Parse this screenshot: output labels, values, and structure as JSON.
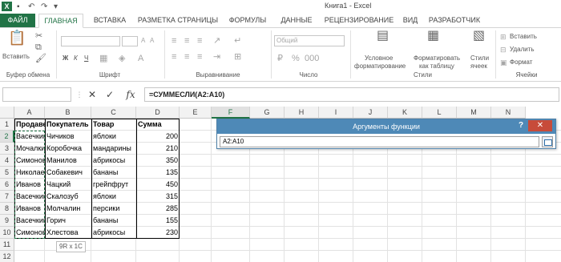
{
  "window": {
    "title": "Книга1 - Excel",
    "logo": "X"
  },
  "qat": {
    "save": "▪",
    "undo": "↶",
    "redo": "↷",
    "customize": "▾"
  },
  "tabs": {
    "file": "ФАЙЛ",
    "items": [
      "ГЛАВНАЯ",
      "ВСТАВКА",
      "РАЗМЕТКА СТРАНИЦЫ",
      "ФОРМУЛЫ",
      "ДАННЫЕ",
      "РЕЦЕНЗИРОВАНИЕ",
      "ВИД",
      "РАЗРАБОТЧИК"
    ],
    "active": "ГЛАВНАЯ"
  },
  "ribbon": {
    "clipboard": {
      "label": "Буфер обмена",
      "paste": "Вставить"
    },
    "font": {
      "label": "Шрифт",
      "bold": "Ж",
      "italic": "К",
      "underline": "Ч",
      "grow": "A",
      "shrink": "A"
    },
    "alignment": {
      "label": "Выравнивание"
    },
    "number": {
      "label": "Число",
      "format": "Общий"
    },
    "styles": {
      "label": "Стили",
      "conditional1": "Условное",
      "conditional2": "форматирование",
      "astable1": "Форматировать",
      "astable2": "как таблицу",
      "cellstyles1": "Стили",
      "cellstyles2": "ячеек"
    },
    "cells": {
      "label": "Ячейки",
      "insert": "Вставить",
      "delete": "Удалить",
      "format": "Формат"
    }
  },
  "formula_bar": {
    "name_box": "",
    "cancel": "✕",
    "enter": "✓",
    "fx": "fx",
    "formula": "=СУММЕСЛИ(A2:A10)"
  },
  "columns": [
    "A",
    "B",
    "C",
    "D",
    "E",
    "F",
    "G",
    "H",
    "I",
    "J",
    "K",
    "L",
    "M",
    "N"
  ],
  "selected_column": "F",
  "rows": [
    "1",
    "2",
    "3",
    "4",
    "5",
    "6",
    "7",
    "8",
    "9",
    "10",
    "11",
    "12"
  ],
  "selected_row": "2",
  "table": {
    "headers": [
      "Продавец",
      "Покупатель",
      "Товар",
      "Сумма"
    ],
    "rows": [
      [
        "Васечкин",
        "Чичиков",
        "яблоки",
        "200"
      ],
      [
        "Мочалкин",
        "Коробочка",
        "мандарины",
        "210"
      ],
      [
        "Симонов",
        "Манилов",
        "абрикосы",
        "350"
      ],
      [
        "Николаев",
        "Собакевич",
        "бананы",
        "135"
      ],
      [
        "Иванов",
        "Чацкий",
        "грейпфрут",
        "450"
      ],
      [
        "Васечкин",
        "Скалозуб",
        "яблоки",
        "315"
      ],
      [
        "Иванов",
        "Молчалин",
        "персики",
        "285"
      ],
      [
        "Васечкин",
        "Горич",
        "бананы",
        "155"
      ],
      [
        "Симонов",
        "Хлестова",
        "абрикосы",
        "230"
      ]
    ]
  },
  "selection_tooltip": "9R x 1C",
  "dialog": {
    "title": "Аргументы функции",
    "help": "?",
    "close": "✕",
    "input_value": "A2:A10"
  }
}
